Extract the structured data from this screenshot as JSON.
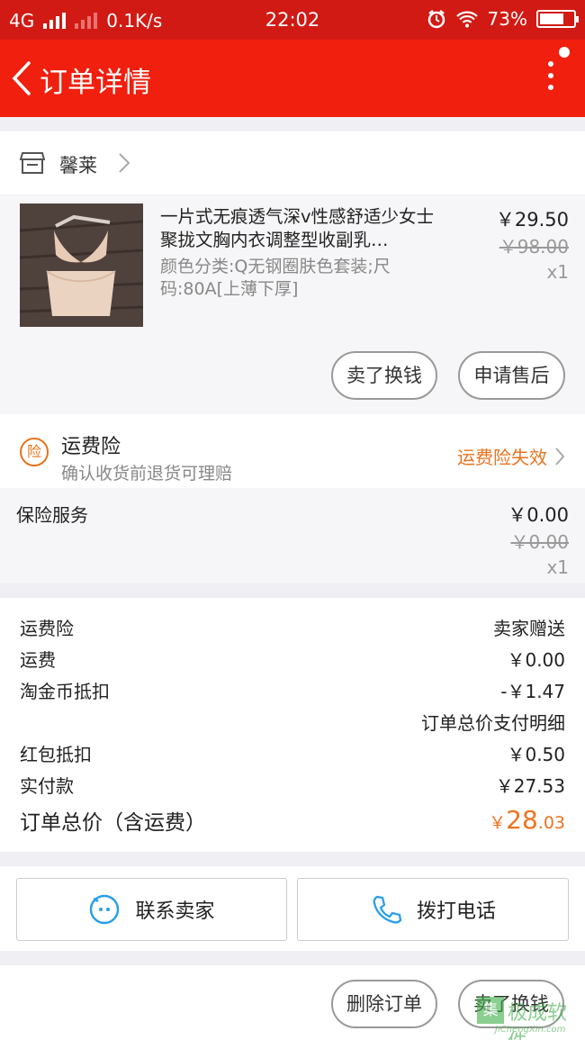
{
  "status_bar": {
    "network": "4G",
    "speed": "0.1K/s",
    "time": "22:02",
    "battery": "73%",
    "battery_level": 0.73
  },
  "nav": {
    "title": "订单详情"
  },
  "shop": {
    "name": "馨莱"
  },
  "product": {
    "title": "一片式无痕透气深v性感舒适少女士聚拢文胸内衣调整型收副乳…",
    "sku": "颜色分类:Q无钢圈肤色套装;尺码:80A[上薄下厚]",
    "price": "￥29.50",
    "original_price": "￥98.00",
    "quantity": "x1",
    "actions": {
      "sell": "卖了换钱",
      "after_sale": "申请售后"
    }
  },
  "shipping_insurance": {
    "badge": "险",
    "title": "运费险",
    "desc": "确认收货前退货可理赔",
    "status_link": "运费险失效"
  },
  "insurance_service": {
    "label": "保险服务",
    "price": "￥0.00",
    "original_price": "￥0.00",
    "quantity": "x1"
  },
  "summary": {
    "rows": [
      {
        "label": "运费险",
        "value": "卖家赠送"
      },
      {
        "label": "运费",
        "value": "￥0.00"
      },
      {
        "label": "淘金币抵扣",
        "value": "-￥1.47"
      },
      {
        "label": "",
        "value": "订单总价支付明细"
      },
      {
        "label": "红包抵扣",
        "value": "￥0.50"
      },
      {
        "label": "实付款",
        "value": "￥27.53"
      }
    ],
    "total_label": "订单总价（含运费）",
    "total_currency": "￥",
    "total_int": "28",
    "total_dec": ".03"
  },
  "contact": {
    "seller": "联系卖家",
    "phone": "拨打电话"
  },
  "footer": {
    "delete": "删除订单",
    "sell": "卖了换钱"
  },
  "watermark": {
    "mark": "集",
    "cn": "极成软件",
    "en": "JiChengXin.com"
  },
  "colors": {
    "primary_red": "#f01f0e",
    "status_red": "#d11a14",
    "accent_orange": "#e8731e"
  }
}
